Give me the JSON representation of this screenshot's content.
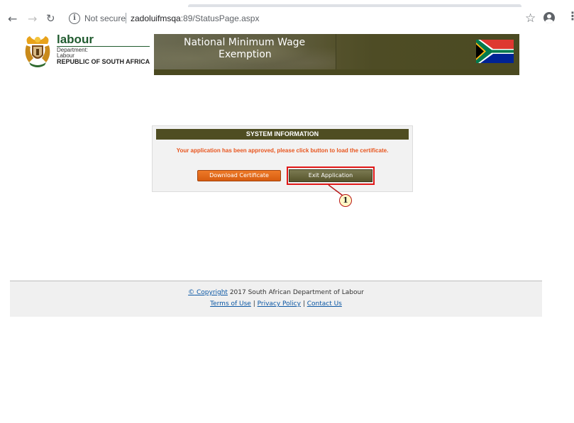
{
  "browser": {
    "security_label": "Not secure",
    "host": "zadoluifmsqa",
    "path": ":89/StatusPage.aspx",
    "icons": [
      "back-icon",
      "forward-icon",
      "reload-icon",
      "info-icon",
      "star-icon",
      "account-icon",
      "menu-icon"
    ]
  },
  "header": {
    "logo_title": "labour",
    "logo_line1": "Department:",
    "logo_line2": "Labour",
    "logo_line3": "REPUBLIC OF SOUTH AFRICA",
    "banner_title_line1": "National Minimum Wage",
    "banner_title_line2": "Exemption"
  },
  "panel": {
    "heading": "SYSTEM INFORMATION",
    "message": "Your application has been approved, please click button to load the certificate.",
    "download_label": "Download Certificate",
    "exit_label": "Exit Application"
  },
  "annotation": {
    "callout_number": "1",
    "highlight_color": "#e01717"
  },
  "footer": {
    "copyright_symbol": "©",
    "copyright_link": " Copyright",
    "copyright_text": " 2017 South African Department of Labour",
    "links": [
      "Terms of Use",
      "Privacy Policy",
      "Contact Us"
    ],
    "separator": " | "
  },
  "colors": {
    "header_olive": "#4f4d22",
    "message_orange": "#e8551e",
    "download_orange": "#e06a1b",
    "link_blue": "#0b57a4",
    "logo_green": "#1f5a2e"
  }
}
